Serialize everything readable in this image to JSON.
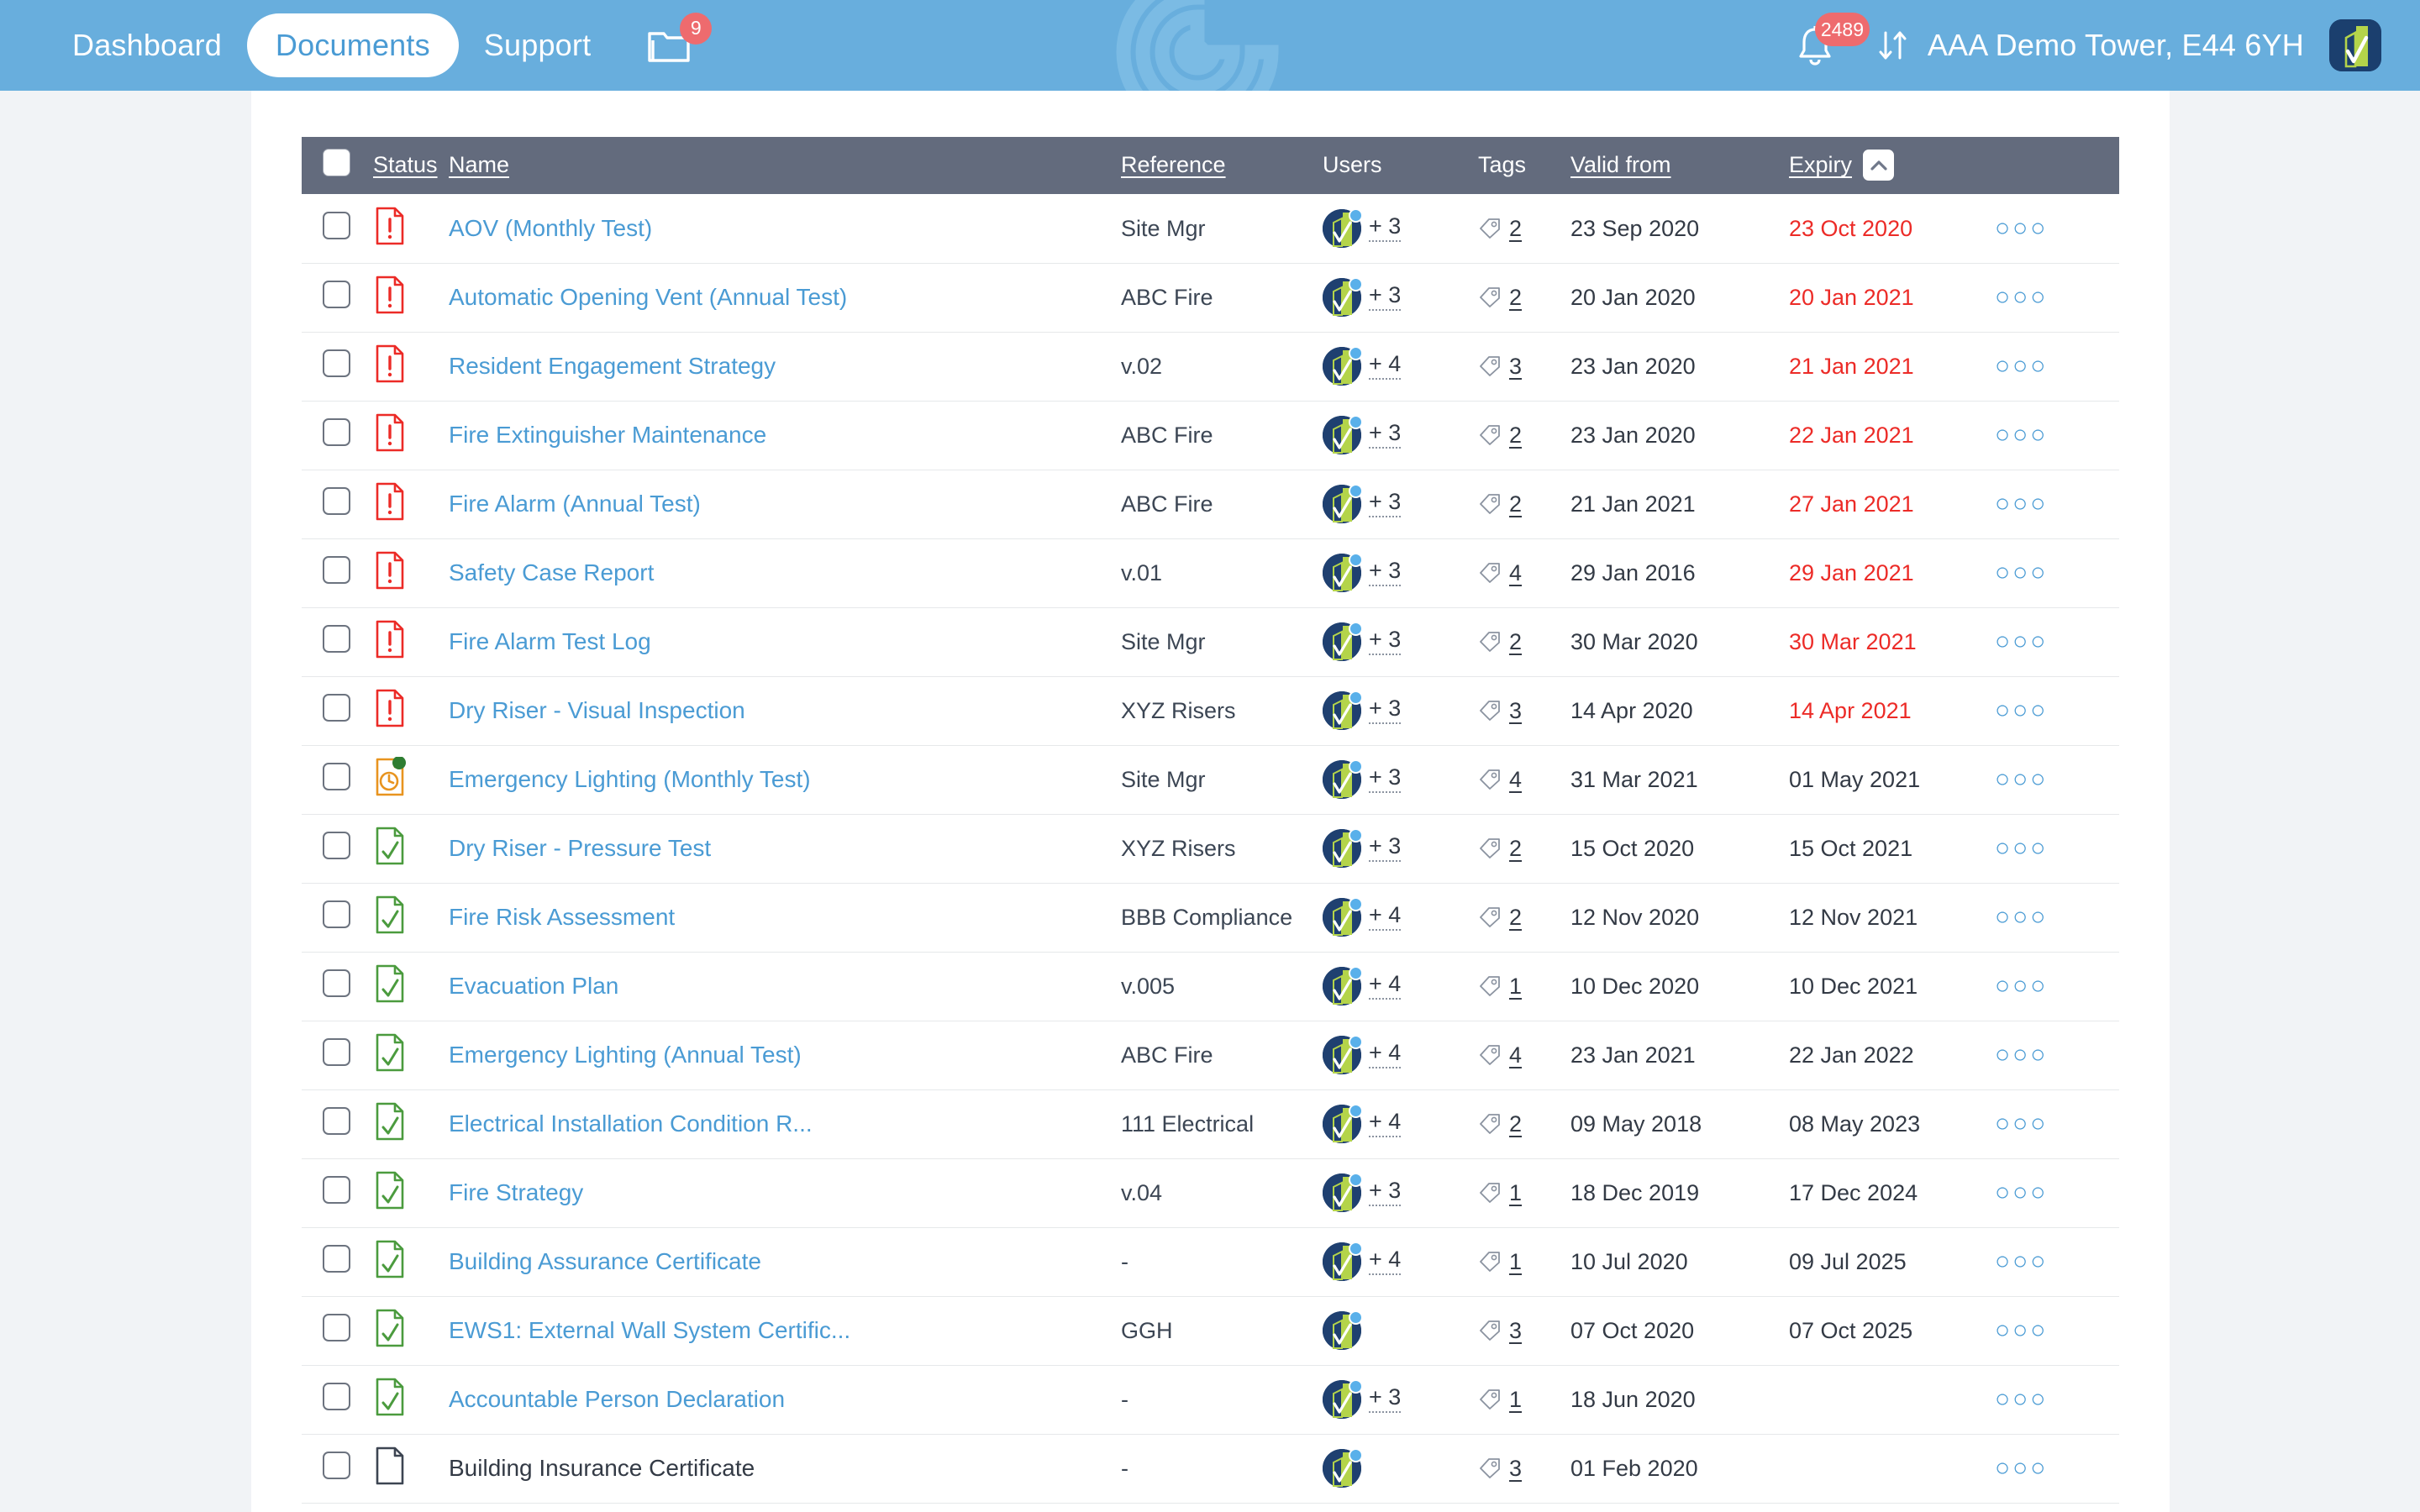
{
  "header": {
    "nav": [
      {
        "label": "Dashboard",
        "active": false
      },
      {
        "label": "Documents",
        "active": true
      },
      {
        "label": "Support",
        "active": false
      }
    ],
    "folder_icon": "folder-icon",
    "folder_badge": "9",
    "bell_icon": "bell-icon",
    "bell_badge": "2489",
    "swap_icon": "sort-swap-icon",
    "building_name": "AAA Demo Tower, E44 6YH",
    "logo": "app-logo-icon",
    "watermark": "concentric-rings-watermark",
    "bg_color": "#68aedd",
    "badge_color": "#ee6b6e"
  },
  "table": {
    "select_all_checkbox": "select-all-checkbox",
    "columns": [
      {
        "key": "status",
        "label": "Status",
        "sortable": true
      },
      {
        "key": "name",
        "label": "Name",
        "sortable": true
      },
      {
        "key": "reference",
        "label": "Reference",
        "sortable": true
      },
      {
        "key": "users",
        "label": "Users",
        "sortable": false
      },
      {
        "key": "tags",
        "label": "Tags",
        "sortable": false
      },
      {
        "key": "valid_from",
        "label": "Valid from",
        "sortable": true
      },
      {
        "key": "expiry",
        "label": "Expiry",
        "sortable": true
      }
    ],
    "sorted_by": "Expiry",
    "sort_direction": "asc",
    "sort_icon": "chevron-up-icon",
    "header_bg": "#636b7d",
    "rows": [
      {
        "status": "expired",
        "name": "AOV (Monthly Test)",
        "name_link": true,
        "reference": "Site Mgr",
        "avatar": true,
        "extra_users": "+ 3",
        "tags": "2",
        "valid_from": "23 Sep 2020",
        "expiry": "23 Oct 2020",
        "expiry_expired": true
      },
      {
        "status": "expired",
        "name": "Automatic Opening Vent (Annual Test)",
        "name_link": true,
        "reference": "ABC Fire",
        "avatar": true,
        "extra_users": "+ 3",
        "tags": "2",
        "valid_from": "20 Jan 2020",
        "expiry": "20 Jan 2021",
        "expiry_expired": true
      },
      {
        "status": "expired",
        "name": "Resident Engagement Strategy",
        "name_link": true,
        "reference": "v.02",
        "avatar": true,
        "extra_users": "+ 4",
        "tags": "3",
        "valid_from": "23 Jan 2020",
        "expiry": "21 Jan 2021",
        "expiry_expired": true
      },
      {
        "status": "expired",
        "name": "Fire Extinguisher Maintenance",
        "name_link": true,
        "reference": "ABC Fire",
        "avatar": true,
        "extra_users": "+ 3",
        "tags": "2",
        "valid_from": "23 Jan 2020",
        "expiry": "22 Jan 2021",
        "expiry_expired": true
      },
      {
        "status": "expired",
        "name": "Fire Alarm (Annual Test)",
        "name_link": true,
        "reference": "ABC Fire",
        "avatar": true,
        "extra_users": "+ 3",
        "tags": "2",
        "valid_from": "21 Jan 2021",
        "expiry": "27 Jan 2021",
        "expiry_expired": true
      },
      {
        "status": "expired",
        "name": "Safety Case Report",
        "name_link": true,
        "reference": "v.01",
        "avatar": true,
        "extra_users": "+ 3",
        "tags": "4",
        "valid_from": "29 Jan 2016",
        "expiry": "29 Jan 2021",
        "expiry_expired": true
      },
      {
        "status": "expired",
        "name": "Fire Alarm Test Log",
        "name_link": true,
        "reference": "Site Mgr",
        "avatar": true,
        "extra_users": "+ 3",
        "tags": "2",
        "valid_from": "30 Mar 2020",
        "expiry": "30 Mar 2021",
        "expiry_expired": true
      },
      {
        "status": "expired",
        "name": "Dry Riser - Visual Inspection",
        "name_link": true,
        "reference": "XYZ Risers",
        "avatar": true,
        "extra_users": "+ 3",
        "tags": "3",
        "valid_from": "14 Apr 2020",
        "expiry": "14 Apr 2021",
        "expiry_expired": true
      },
      {
        "status": "due",
        "name": "Emergency Lighting (Monthly Test)",
        "name_link": true,
        "reference": "Site Mgr",
        "avatar": true,
        "extra_users": "+ 3",
        "tags": "4",
        "valid_from": "31 Mar 2021",
        "expiry": "01 May 2021",
        "expiry_expired": false
      },
      {
        "status": "valid",
        "name": "Dry Riser - Pressure Test",
        "name_link": true,
        "reference": "XYZ Risers",
        "avatar": true,
        "extra_users": "+ 3",
        "tags": "2",
        "valid_from": "15 Oct 2020",
        "expiry": "15 Oct 2021",
        "expiry_expired": false
      },
      {
        "status": "valid",
        "name": "Fire Risk Assessment",
        "name_link": true,
        "reference": "BBB Compliance",
        "avatar": true,
        "extra_users": "+ 4",
        "tags": "2",
        "valid_from": "12 Nov 2020",
        "expiry": "12 Nov 2021",
        "expiry_expired": false
      },
      {
        "status": "valid",
        "name": "Evacuation Plan",
        "name_link": true,
        "reference": "v.005",
        "avatar": true,
        "extra_users": "+ 4",
        "tags": "1",
        "valid_from": "10 Dec 2020",
        "expiry": "10 Dec 2021",
        "expiry_expired": false
      },
      {
        "status": "valid",
        "name": "Emergency Lighting (Annual Test)",
        "name_link": true,
        "reference": "ABC Fire",
        "avatar": true,
        "extra_users": "+ 4",
        "tags": "4",
        "valid_from": "23 Jan 2021",
        "expiry": "22 Jan 2022",
        "expiry_expired": false
      },
      {
        "status": "valid",
        "name": "Electrical Installation Condition R...",
        "name_link": true,
        "reference": "111 Electrical",
        "avatar": true,
        "extra_users": "+ 4",
        "tags": "2",
        "valid_from": "09 May 2018",
        "expiry": "08 May 2023",
        "expiry_expired": false
      },
      {
        "status": "valid",
        "name": "Fire Strategy",
        "name_link": true,
        "reference": "v.04",
        "avatar": true,
        "extra_users": "+ 3",
        "tags": "1",
        "valid_from": "18 Dec 2019",
        "expiry": "17 Dec 2024",
        "expiry_expired": false
      },
      {
        "status": "valid",
        "name": "Building Assurance Certificate",
        "name_link": true,
        "reference": "-",
        "avatar": true,
        "extra_users": "+ 4",
        "tags": "1",
        "valid_from": "10 Jul 2020",
        "expiry": "09 Jul 2025",
        "expiry_expired": false
      },
      {
        "status": "valid",
        "name": "EWS1: External Wall System Certific...",
        "name_link": true,
        "reference": "GGH",
        "avatar": true,
        "extra_users": "",
        "tags": "3",
        "valid_from": "07 Oct 2020",
        "expiry": "07 Oct 2025",
        "expiry_expired": false
      },
      {
        "status": "valid",
        "name": "Accountable Person Declaration",
        "name_link": true,
        "reference": "-",
        "avatar": true,
        "extra_users": "+ 3",
        "tags": "1",
        "valid_from": "18 Jun 2020",
        "expiry": "",
        "expiry_expired": false
      },
      {
        "status": "none",
        "name": "Building Insurance Certificate",
        "name_link": false,
        "reference": "-",
        "avatar": true,
        "extra_users": "",
        "tags": "3",
        "valid_from": "01 Feb 2020",
        "expiry": "",
        "expiry_expired": false
      }
    ],
    "row_more_icon": "more-options-icon",
    "status_icons": {
      "expired": "document-alert-icon",
      "due": "document-clock-icon",
      "valid": "document-check-icon",
      "none": "document-blank-icon"
    },
    "colors": {
      "link": "#4a9bd4",
      "expired": "#ec2b27",
      "due": "#e8941f",
      "valid": "#4b9b3e"
    }
  }
}
